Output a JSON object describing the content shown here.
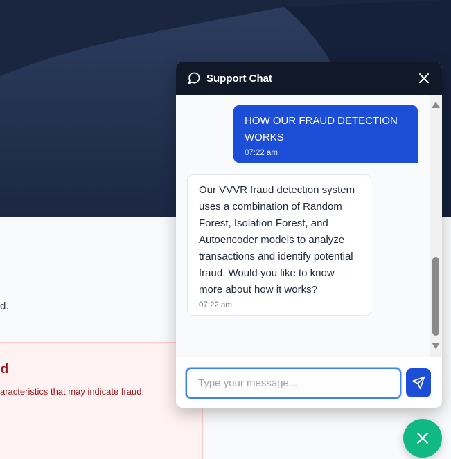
{
  "background": {
    "body_fragment": "d.",
    "alert_title_fragment": "ed",
    "alert_sub_fragment": "aracteristics that may indicate fraud."
  },
  "chat": {
    "title": "Support Chat",
    "header_icon": "message-circle-icon",
    "close_icon": "close-icon",
    "messages": [
      {
        "role": "user",
        "text": "HOW OUR FRAUD DETECTION WORKS",
        "time": "07:22 am"
      },
      {
        "role": "bot",
        "text": "Our VVVR fraud detection system uses a combination of Random Forest, Isolation Forest, and Autoencoder models to analyze transactions and identify potential fraud. Would you like to know more about how it works?",
        "time": "07:22 am"
      }
    ],
    "input": {
      "placeholder": "Type your message...",
      "value": ""
    },
    "send_icon": "send-icon"
  },
  "fab": {
    "icon": "close-icon"
  },
  "colors": {
    "header_bg": "#111827",
    "user_bubble": "#1d4ed8",
    "fab": "#10b981"
  }
}
